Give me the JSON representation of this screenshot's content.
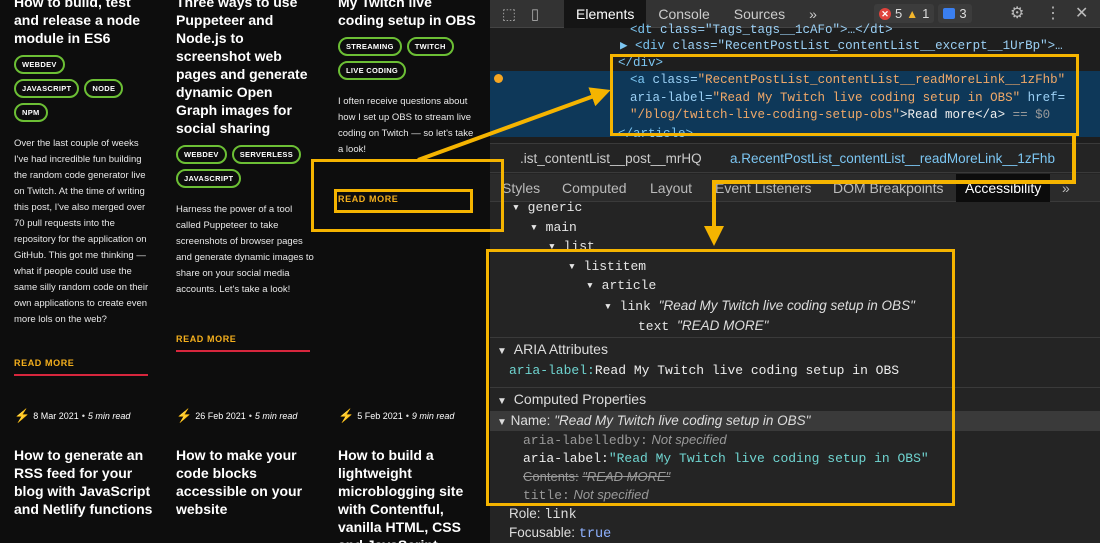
{
  "blog": {
    "posts_top": [
      {
        "title": "How to build, test and release a node module in ES6",
        "tags": [
          "WEBDEV",
          "JAVASCRIPT",
          "NODE",
          "NPM"
        ],
        "excerpt": "Over the last couple of weeks I've had incredible fun building the random code generator live on Twitch. At the time of writing this post, I've also merged over 70 pull requests into the repository for the application on GitHub. This got me thinking — what if people could use the same silly random code on their own applications to create even more lols on the web?",
        "read_more": "READ MORE"
      },
      {
        "title": "Three ways to use Puppeteer and Node.js to screenshot web pages and generate dynamic Open Graph images for social sharing",
        "tags": [
          "WEBDEV",
          "SERVERLESS",
          "JAVASCRIPT"
        ],
        "excerpt": "Harness the power of a tool called Puppeteer to take screenshots of browser pages and generate dynamic images to share on your social media accounts. Let's take a look!",
        "read_more": "READ MORE"
      },
      {
        "title": "My Twitch live coding setup in OBS",
        "tags": [
          "STREAMING",
          "TWITCH",
          "LIVE CODING"
        ],
        "excerpt": "I often receive questions about how I set up OBS to stream live coding on Twitch — so let's take a look!",
        "read_more": "READ MORE"
      }
    ],
    "posts_bottom": [
      {
        "date": "8 Mar 2021",
        "sep": "•",
        "mins": "5 min read",
        "title": "How to generate an RSS feed for your blog with JavaScript and Netlify functions"
      },
      {
        "date": "26 Feb 2021",
        "sep": "•",
        "mins": "5 min read",
        "title": "How to make your code blocks accessible on your website"
      },
      {
        "date": "5 Feb 2021",
        "sep": "•",
        "mins": "9 min read",
        "title": "How to build a lightweight microblogging site with Contentful, vanilla HTML, CSS and JavaScript"
      }
    ]
  },
  "devtools": {
    "tabs": [
      "Elements",
      "Console",
      "Sources",
      "»"
    ],
    "active_tab": "Elements",
    "errors": "5",
    "warnings": "1",
    "info": "3",
    "code_lines": [
      {
        "pre": "<",
        "tag": "dt",
        "rest": " class=\"Tags_tags__1cAFo\">…</dt>"
      },
      {
        "pre": "▶ <",
        "tag": "div",
        "rest": " class=\"RecentPostList_contentList__excerpt__1UrBp\">…"
      },
      {
        "close": "</div>"
      },
      {
        "pre": "<",
        "tag": "a",
        "attr1": "class",
        "val1": "\"RecentPostList_contentList__readMoreLink__1zFhb\""
      },
      {
        "attr2": "aria-label",
        "val2": "\"Read My Twitch live coding setup in OBS\"",
        "attr3": "href="
      },
      {
        "val3": "\"/blog/twitch-live-coding-setup-obs\"",
        "text": ">Read more</a>",
        "eq": " == $0"
      },
      {
        "close": "</article>"
      }
    ],
    "crumbs": [
      ".ist_contentList__post__mrHQ",
      "a.RecentPostList_contentList__readMoreLink__1zFhb"
    ],
    "subtabs": [
      "Styles",
      "Computed",
      "Layout",
      "Event Listeners",
      "DOM Breakpoints",
      "Accessibility",
      "»"
    ],
    "active_subtab": "Accessibility",
    "tree": {
      "generic": "generic",
      "main": "main",
      "list": "list",
      "listitem": "listitem",
      "article": "article",
      "link_role": "link",
      "link_name": "\"Read My Twitch live coding setup in OBS\"",
      "text_role": "text",
      "text_name": "\"READ MORE\""
    },
    "aria_attributes": {
      "header": "ARIA Attributes",
      "key": "aria-label:",
      "value": "Read My Twitch live coding setup in OBS"
    },
    "computed": {
      "header": "Computed Properties",
      "name_key": "Name:",
      "name_value": "\"Read My Twitch live coding setup in OBS\"",
      "labelledby_key": "aria-labelledby:",
      "labelledby_value": "Not specified",
      "label_key": "aria-label:",
      "label_value": "\"Read My Twitch live coding setup in OBS\"",
      "contents_key": "Contents:",
      "contents_value": "\"READ MORE\"",
      "title_key": "title:",
      "title_value": "Not specified",
      "role_key": "Role:",
      "role_value": "link",
      "focusable_key": "Focusable:",
      "focusable_value": "true"
    }
  },
  "colors": {
    "highlight": "#f5b400",
    "tag_border": "#6cbf35",
    "read_more": "#f5b01d",
    "read_more_underline": "#d7263d",
    "selected_row": "#0e3859"
  }
}
